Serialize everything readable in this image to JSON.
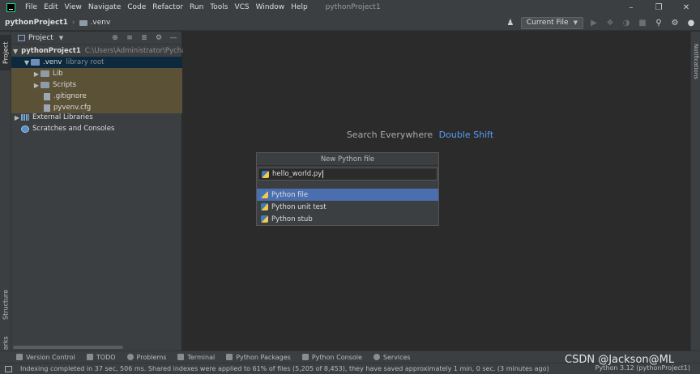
{
  "menubar": {
    "items": [
      "File",
      "Edit",
      "View",
      "Navigate",
      "Code",
      "Refactor",
      "Run",
      "Tools",
      "VCS",
      "Window",
      "Help"
    ],
    "window_title": "pythonProject1"
  },
  "navbar": {
    "project": "pythonProject1",
    "folder": ".venv",
    "run_config": "Current File"
  },
  "left_stripe": {
    "project": "Project",
    "structure": "Structure",
    "bookmarks": "Bookmarks"
  },
  "right_stripe": {
    "notifications": "Notifications"
  },
  "project_panel": {
    "title": "Project",
    "tree": [
      {
        "label": "pythonProject1",
        "hint": "C:\\Users\\Administrator\\Pycha"
      },
      {
        "label": ".venv",
        "hint": "library root"
      },
      {
        "label": "Lib"
      },
      {
        "label": "Scripts"
      },
      {
        "label": ".gitignore"
      },
      {
        "label": "pyvenv.cfg"
      },
      {
        "label": "External Libraries"
      },
      {
        "label": "Scratches and Consoles"
      }
    ]
  },
  "editor": {
    "hint_text": "Search Everywhere",
    "hint_shortcut": "Double Shift"
  },
  "popup": {
    "title": "New Python file",
    "input_value": "hello_world.py",
    "items": [
      "Python file",
      "Python unit test",
      "Python stub"
    ],
    "selected": "Python file"
  },
  "bottom_bar": {
    "tabs": [
      "Version Control",
      "TODO",
      "Problems",
      "Terminal",
      "Python Packages",
      "Python Console",
      "Services"
    ]
  },
  "status_bar": {
    "text": "Indexing completed in 37 sec, 506 ms. Shared indexes were applied to 61% of files (5,205 of 8,453), they have saved approximately 1 min, 0 sec. (3 minutes ago)",
    "interpreter": "Python 3.12 (pythonProject1)"
  },
  "watermark": "CSDN @Jackson@ML",
  "colors": {
    "accent": "#4b6eaf",
    "shortcut": "#589df6",
    "selection_tree": "#0d293e",
    "venv_highlight": "#5b5137"
  }
}
